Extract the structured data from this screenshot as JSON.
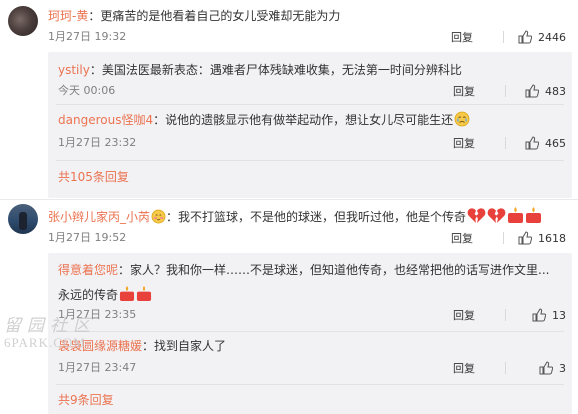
{
  "comments": [
    {
      "user": "珂珂-黄",
      "separator": "：",
      "text": "更痛苦的是他看着自己的女儿受难却无能为力",
      "time": "1月27日 19:32",
      "reply_label": "回复",
      "likes": "2446",
      "replies": [
        {
          "user": "ystily",
          "separator": "：",
          "text": "美国法医最新表态：遇难者尸体残缺难收集，无法第一时间分辨科比",
          "time": "今天 00:06",
          "reply_label": "回复",
          "likes": "483"
        },
        {
          "user": "dangerous怪咖4",
          "separator": "：",
          "text": "说他的遗骸显示他有做举起动作，想让女儿尽可能生还",
          "time": "1月27日 23:32",
          "reply_label": "回复",
          "likes": "465"
        }
      ],
      "more_label": "共105条回复"
    },
    {
      "user": "张小辫儿家丙_小芮",
      "separator": "：",
      "text": "我不打篮球，不是他的球迷，但我听过他，他是个传奇",
      "time": "1月27日 19:52",
      "reply_label": "回复",
      "likes": "1618",
      "replies": [
        {
          "user": "得意着您呢",
          "separator": "：",
          "text": "家人？我和你一样……不是球迷，但知道他传奇，也经常把他的话写进作文里...",
          "text2": "永远的传奇",
          "time": "1月27日 23:35",
          "reply_label": "回复",
          "likes": "13"
        },
        {
          "user": "袅袅圆缘源糖媛",
          "separator": "：",
          "text": "找到自家人了",
          "time": "1月27日 23:47",
          "reply_label": "回复",
          "likes": "3"
        }
      ],
      "more_label": "共9条回复"
    }
  ],
  "watermark": {
    "line1": "留园社区",
    "line2": "6PARK.COM"
  },
  "colors": {
    "name": "#eb7350",
    "time": "#808080",
    "reply_bg": "#f2f2f5",
    "heart": "#e8413c",
    "candle": "#e8413c"
  },
  "icons": {
    "like": "thumb-up-icon",
    "broken_heart": "broken-heart-icon",
    "candle": "candle-icon",
    "crying": "crying-face-icon",
    "shy": "shy-face-icon"
  }
}
